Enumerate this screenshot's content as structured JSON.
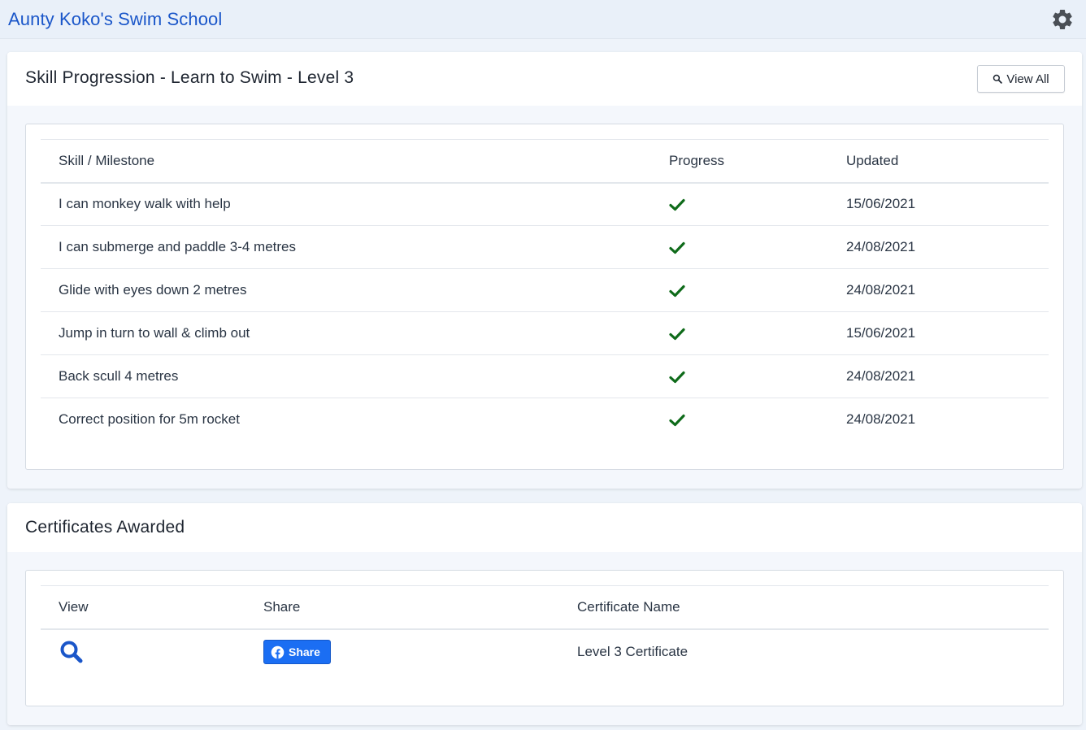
{
  "app": {
    "title": "Aunty Koko's Swim School"
  },
  "icons": {
    "settings": "gear-icon",
    "search": "search-icon",
    "check": "check-icon",
    "facebook": "facebook-icon"
  },
  "colors": {
    "brand": "#1a56c9",
    "check": "#0f6b1a",
    "facebook": "#1b6ef3"
  },
  "skills": {
    "title": "Skill Progression - Learn to Swim - Level 3",
    "view_all_label": "View All",
    "columns": [
      "Skill / Milestone",
      "Progress",
      "Updated"
    ],
    "rows": [
      {
        "skill": "I can monkey walk with help",
        "complete": true,
        "updated": "15/06/2021"
      },
      {
        "skill": "I can submerge and paddle 3-4 metres",
        "complete": true,
        "updated": "24/08/2021"
      },
      {
        "skill": "Glide with eyes down 2 metres",
        "complete": true,
        "updated": "24/08/2021"
      },
      {
        "skill": "Jump in turn to wall & climb out",
        "complete": true,
        "updated": "15/06/2021"
      },
      {
        "skill": "Back scull 4 metres",
        "complete": true,
        "updated": "24/08/2021"
      },
      {
        "skill": "Correct position for 5m rocket",
        "complete": true,
        "updated": "24/08/2021"
      }
    ]
  },
  "certificates": {
    "title": "Certificates Awarded",
    "columns": [
      "View",
      "Share",
      "Certificate Name"
    ],
    "rows": [
      {
        "share_label": "Share",
        "name": "Level 3 Certificate"
      }
    ]
  }
}
